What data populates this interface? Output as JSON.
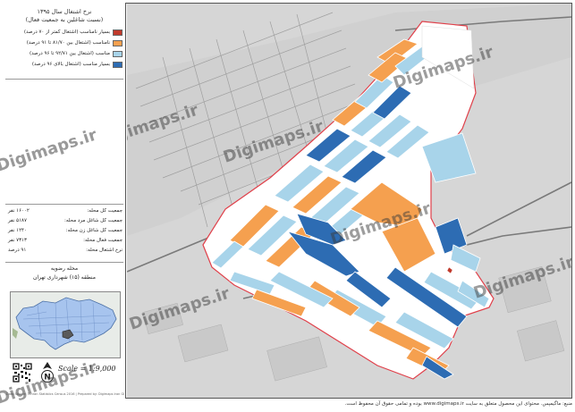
{
  "panel": {
    "title_line1": "نرخ اشتغال سال ۱۳۹۵",
    "title_line2": "(نسبت شاغلین به جمعیت فعال)",
    "legend": [
      {
        "label": "بسیار نامناسب (اشتغال کمتر از ۷۰ درصد)",
        "color": "#c0392b"
      },
      {
        "label": "نامناسب (اشتغال بین ۸۱/۷۰ تا ۹۱ درصد)",
        "color": "#f5a04f"
      },
      {
        "label": "مناسب (اشتغال بین ۹۲/۷۱ تا ۹۶ درصد)",
        "color": "#a8d4ea"
      },
      {
        "label": "بسیار مناسب (اشتغال بالای ۹۶ درصد)",
        "color": "#2d6cb3"
      }
    ],
    "stats": [
      {
        "label": "جمعیت کل محله:",
        "value": "۱۶۰۰۲ نفر"
      },
      {
        "label": "جمعیت کل شاغل مرد محله:",
        "value": "۵۱۸۷ نفر"
      },
      {
        "label": "جمعیت کل شاغل زن محله:",
        "value": "۱۲۴۰ نفر"
      },
      {
        "label": "جمعیت فعال محله:",
        "value": "۷۳۱۳ نفر"
      },
      {
        "label": "نرخ اشتغال محله:",
        "value": "۹۱ درصد"
      }
    ],
    "location_title1": "محله رضویه",
    "location_title2": "منطقه (۱۵) شهرداری تهران",
    "scale": "Scale = 1:9,000",
    "credit": "Data Source: Tehran Statistics Census 2016 | Prepared by: Digimaps Iran GIS Department"
  },
  "watermark": "Digimaps.ir",
  "footer": "منبع: ماگیمپس. محتوای این محصول متعلق به سایت www.digimaps.ir بوده و تمامی حقوق آن محفوظ است.",
  "colors": {
    "very_poor": "#c0392b",
    "poor": "#f5a04f",
    "good": "#a8d4ea",
    "very_good": "#2d6cb3",
    "basemap": "#d9d9d9",
    "boundary": "#e0404a"
  }
}
